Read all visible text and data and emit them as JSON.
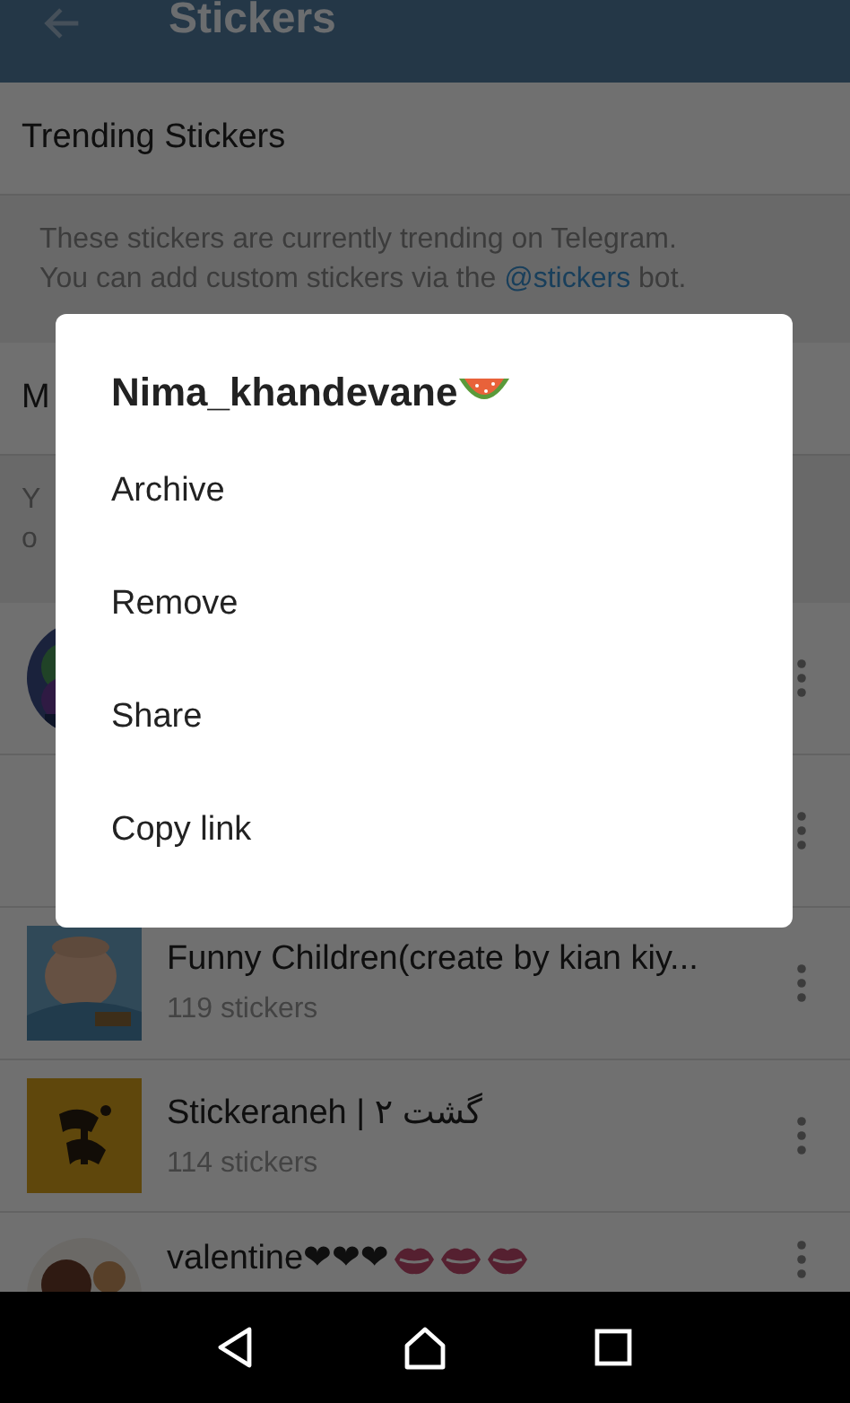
{
  "app_bar": {
    "title": "Stickers"
  },
  "trending_row": {
    "label": "Trending Stickers"
  },
  "trending_info": {
    "line_1": "These stickers are currently trending on Telegram.",
    "line_2": "You can add custom stickers via the",
    "link": "@stickers",
    "line_2_end": "bot."
  },
  "masks_row": {
    "label": "M"
  },
  "masks_info": {
    "line_1": "Y",
    "line_2": "o"
  },
  "sticker_sets": [
    {
      "kind": "round"
    },
    {
      "kind": "none"
    },
    {
      "kind": "square",
      "title": "Funny Children(create by kian kiy...",
      "count": "119 stickers"
    },
    {
      "kind": "square",
      "title": "Stickeraneh | گشت ۲",
      "count": "114 stickers"
    },
    {
      "kind": "round",
      "title": "valentine❤❤❤",
      "title_icons": [
        {
          "kind": "lips"
        },
        {
          "kind": "lips"
        },
        {
          "kind": "lips"
        }
      ]
    }
  ],
  "dialog": {
    "title": "Nima_khandevane",
    "title_icon": {
      "kind": "watermelon"
    },
    "items": [
      {
        "label": "Archive"
      },
      {
        "label": "Remove"
      },
      {
        "label": "Share"
      },
      {
        "label": "Copy link"
      }
    ]
  }
}
